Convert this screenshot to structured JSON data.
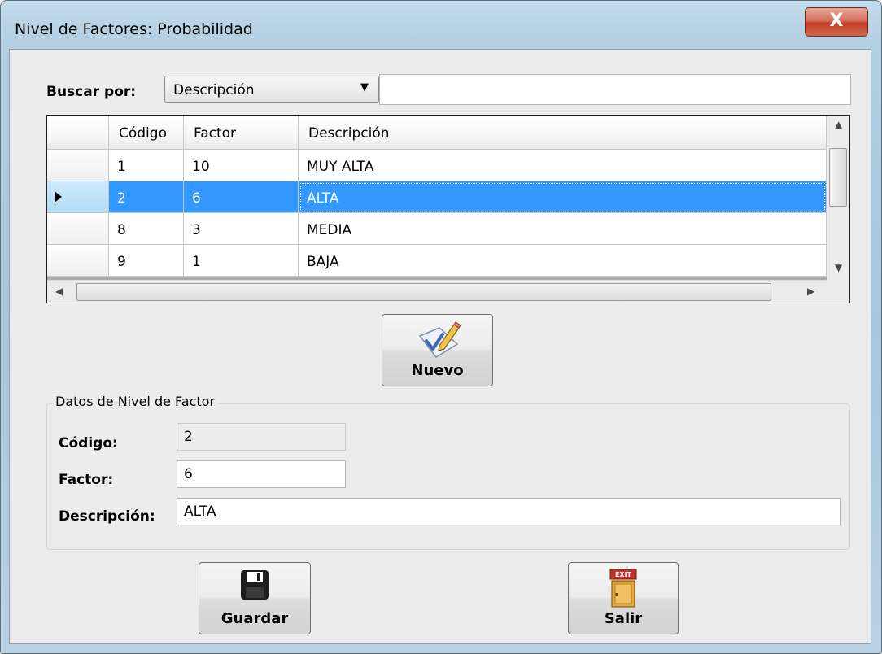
{
  "window": {
    "title": "Nivel de Factores: Probabilidad",
    "close_glyph": "X"
  },
  "search": {
    "label": "Buscar por:",
    "selected": "Descripción",
    "value": ""
  },
  "grid": {
    "headers": [
      "Código",
      "Factor",
      "Descripción"
    ],
    "rows": [
      {
        "codigo": "1",
        "factor": "10",
        "descripcion": "MUY ALTA"
      },
      {
        "codigo": "2",
        "factor": "6",
        "descripcion": "ALTA"
      },
      {
        "codigo": "8",
        "factor": "3",
        "descripcion": "MEDIA"
      },
      {
        "codigo": "9",
        "factor": "1",
        "descripcion": "BAJA"
      }
    ],
    "selected_index": 1
  },
  "buttons": {
    "nuevo": "Nuevo",
    "guardar": "Guardar",
    "salir": "Salir",
    "exit_sign": "EXIT"
  },
  "details": {
    "group_title": "Datos de Nivel de Factor",
    "codigo_label": "Código:",
    "codigo": "2",
    "factor_label": "Factor:",
    "factor": "6",
    "descripcion_label": "Descripción:",
    "descripcion": "ALTA"
  },
  "icons": {
    "nuevo": "pencil-check-icon",
    "guardar": "floppy-disk-icon",
    "salir": "exit-door-icon"
  }
}
